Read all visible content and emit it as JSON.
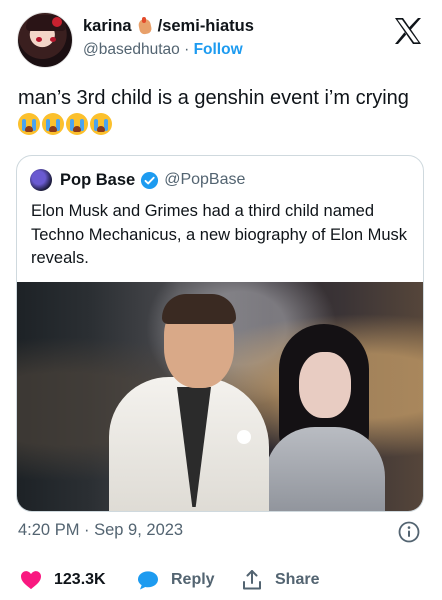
{
  "author": {
    "display_name_prefix": "karina",
    "display_name_suffix": "/semi-hiatus",
    "handle": "@basedhutao",
    "separator": "·",
    "follow_label": "Follow"
  },
  "tweet": {
    "text": "man’s 3rd child is a genshin event i’m crying",
    "emoji_count": 4,
    "timestamp": "4:20 PM · Sep 9, 2023"
  },
  "quoted": {
    "name": "Pop Base",
    "handle": "@PopBase",
    "text": "Elon Musk and Grimes had a third child named Techno Mechanicus, a new biography of Elon Musk reveals."
  },
  "actions": {
    "like_count": "123.3K",
    "reply_label": "Reply",
    "share_label": "Share"
  },
  "colors": {
    "accent": "#1d9bf0",
    "like": "#f91880",
    "text": "#0f1419",
    "muted": "#536471",
    "border": "#cfd9de"
  },
  "icons": {
    "platform": "x-logo-icon",
    "verified": "verified-badge-icon",
    "info": "info-icon",
    "like": "heart-icon",
    "reply": "speech-bubble-icon",
    "share": "upload-share-icon",
    "emoji_name": "fire-hand-emoji",
    "emoji_text": "loudly-crying-face-emoji"
  }
}
